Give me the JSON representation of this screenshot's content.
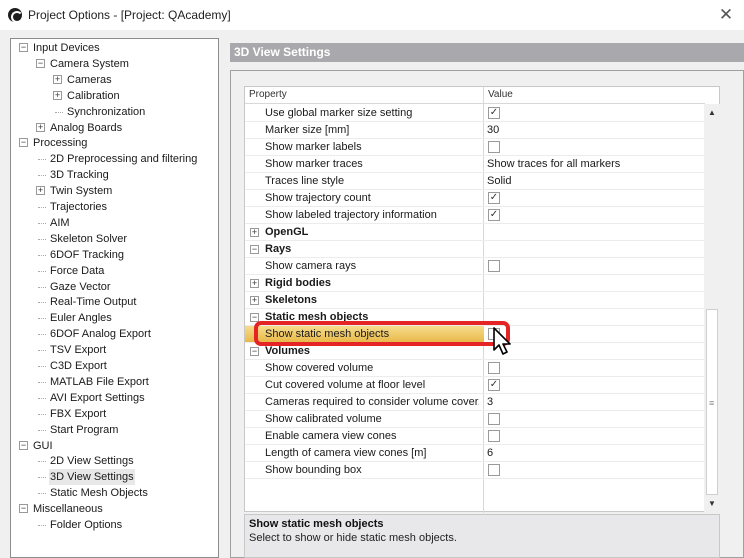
{
  "window": {
    "title": "Project Options - [Project: QAcademy]"
  },
  "header": {
    "title": "3D View Settings"
  },
  "tree": [
    {
      "label": "Input Devices",
      "indent": 0,
      "exp": "minus"
    },
    {
      "label": "Camera System",
      "indent": 1,
      "exp": "minus"
    },
    {
      "label": "Cameras",
      "indent": 2,
      "exp": "plus"
    },
    {
      "label": "Calibration",
      "indent": 2,
      "exp": "plus"
    },
    {
      "label": "Synchronization",
      "indent": 2,
      "exp": ""
    },
    {
      "label": "Analog Boards",
      "indent": 1,
      "exp": "plus"
    },
    {
      "label": "Processing",
      "indent": 0,
      "exp": "minus"
    },
    {
      "label": "2D Preprocessing and filtering",
      "indent": 1,
      "exp": ""
    },
    {
      "label": "3D Tracking",
      "indent": 1,
      "exp": ""
    },
    {
      "label": "Twin System",
      "indent": 1,
      "exp": "plus"
    },
    {
      "label": "Trajectories",
      "indent": 1,
      "exp": ""
    },
    {
      "label": "AIM",
      "indent": 1,
      "exp": ""
    },
    {
      "label": "Skeleton Solver",
      "indent": 1,
      "exp": ""
    },
    {
      "label": "6DOF Tracking",
      "indent": 1,
      "exp": ""
    },
    {
      "label": "Force Data",
      "indent": 1,
      "exp": ""
    },
    {
      "label": "Gaze Vector",
      "indent": 1,
      "exp": ""
    },
    {
      "label": "Real-Time Output",
      "indent": 1,
      "exp": ""
    },
    {
      "label": "Euler Angles",
      "indent": 1,
      "exp": ""
    },
    {
      "label": "6DOF Analog Export",
      "indent": 1,
      "exp": ""
    },
    {
      "label": "TSV Export",
      "indent": 1,
      "exp": ""
    },
    {
      "label": "C3D Export",
      "indent": 1,
      "exp": ""
    },
    {
      "label": "MATLAB File Export",
      "indent": 1,
      "exp": ""
    },
    {
      "label": "AVI Export Settings",
      "indent": 1,
      "exp": ""
    },
    {
      "label": "FBX Export",
      "indent": 1,
      "exp": ""
    },
    {
      "label": "Start Program",
      "indent": 1,
      "exp": ""
    },
    {
      "label": "GUI",
      "indent": 0,
      "exp": "minus"
    },
    {
      "label": "2D View Settings",
      "indent": 1,
      "exp": ""
    },
    {
      "label": "3D View Settings",
      "indent": 1,
      "exp": "",
      "selected": true
    },
    {
      "label": "Static Mesh Objects",
      "indent": 1,
      "exp": ""
    },
    {
      "label": "Miscellaneous",
      "indent": 0,
      "exp": "minus"
    },
    {
      "label": "Folder Options",
      "indent": 1,
      "exp": ""
    }
  ],
  "grid": {
    "col_property": "Property",
    "col_value": "Value",
    "rows": [
      {
        "type": "prop",
        "name": "Use global marker size setting",
        "kind": "check",
        "checked": true
      },
      {
        "type": "prop",
        "name": "Marker size [mm]",
        "kind": "text",
        "value": "30"
      },
      {
        "type": "prop",
        "name": "Show marker labels",
        "kind": "check",
        "checked": false
      },
      {
        "type": "prop",
        "name": "Show marker traces",
        "kind": "text",
        "value": "Show traces for all markers"
      },
      {
        "type": "prop",
        "name": "Traces line style",
        "kind": "text",
        "value": "Solid"
      },
      {
        "type": "prop",
        "name": "Show trajectory count",
        "kind": "check",
        "checked": true
      },
      {
        "type": "prop",
        "name": "Show labeled trajectory information",
        "kind": "check",
        "checked": true
      },
      {
        "type": "cat",
        "name": "OpenGL",
        "exp": "plus"
      },
      {
        "type": "cat",
        "name": "Rays",
        "exp": "minus"
      },
      {
        "type": "prop",
        "name": "Show camera rays",
        "kind": "check",
        "checked": false
      },
      {
        "type": "cat",
        "name": "Rigid bodies",
        "exp": "plus"
      },
      {
        "type": "cat",
        "name": "Skeletons",
        "exp": "plus"
      },
      {
        "type": "cat",
        "name": "Static mesh objects",
        "exp": "minus"
      },
      {
        "type": "prop",
        "name": "Show static mesh objects",
        "kind": "check",
        "checked": false,
        "highlight": true
      },
      {
        "type": "cat",
        "name": "Volumes",
        "exp": "minus"
      },
      {
        "type": "prop",
        "name": "Show covered volume",
        "kind": "check",
        "checked": false
      },
      {
        "type": "prop",
        "name": "Cut covered volume at floor level",
        "kind": "check",
        "checked": true
      },
      {
        "type": "prop",
        "name": "Cameras required to consider volume cover...",
        "kind": "text",
        "value": "3"
      },
      {
        "type": "prop",
        "name": "Show calibrated volume",
        "kind": "check",
        "checked": false
      },
      {
        "type": "prop",
        "name": "Enable camera view cones",
        "kind": "check",
        "checked": false
      },
      {
        "type": "prop",
        "name": "Length of camera view cones [m]",
        "kind": "text",
        "value": "6"
      },
      {
        "type": "prop",
        "name": "Show bounding box",
        "kind": "check",
        "checked": false
      }
    ]
  },
  "description": {
    "title": "Show static mesh objects",
    "text": "Select to show or hide static mesh objects."
  },
  "colors": {
    "highlight_ring": "#e52525",
    "header_bg": "#a9a9ad",
    "selected_row": "#f0c860"
  }
}
